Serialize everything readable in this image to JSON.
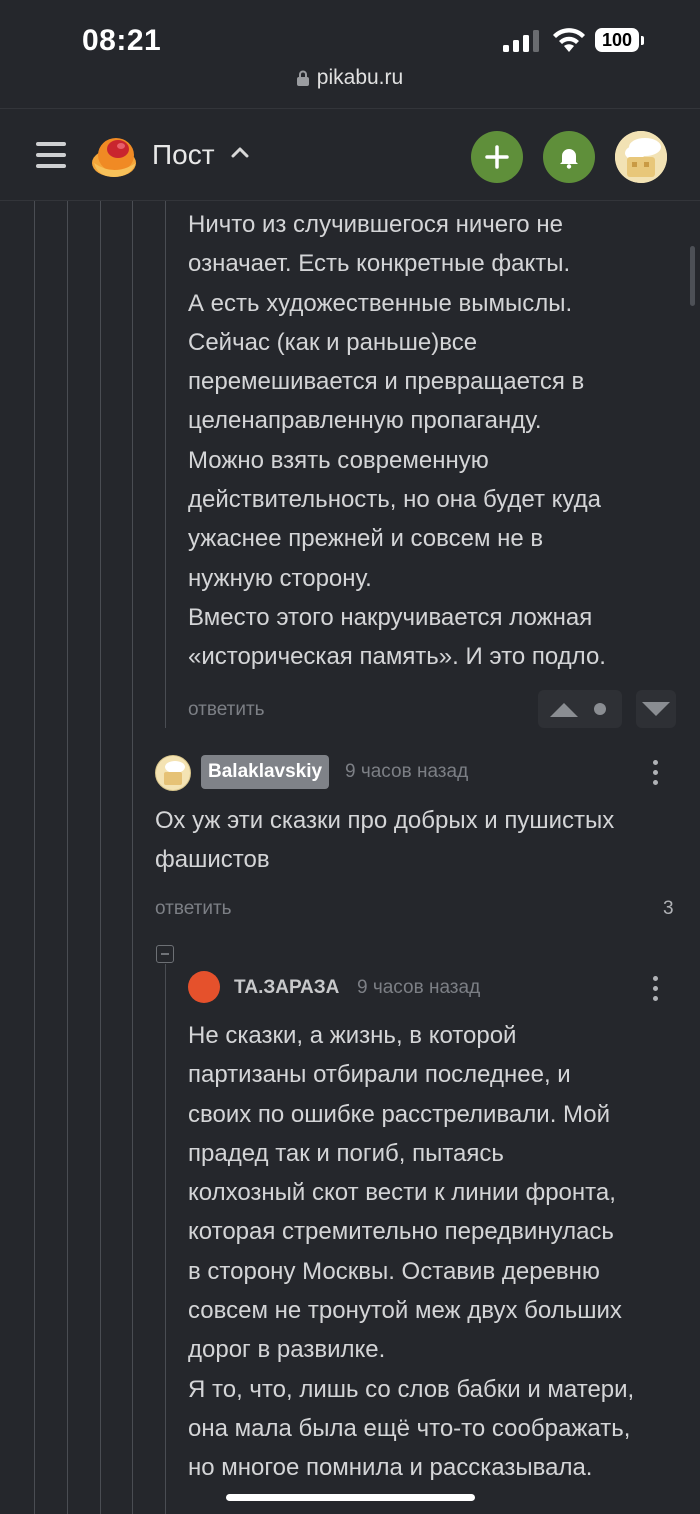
{
  "status_bar": {
    "time": "08:21",
    "battery": "100",
    "url": "pikabu.ru"
  },
  "header": {
    "title": "Пост",
    "menu_icon": "hamburger-icon",
    "logo_icon": "pikabu-logo-icon",
    "add_icon": "plus-icon",
    "bell_icon": "bell-icon",
    "accent": "#5f8f3a"
  },
  "comments": [
    {
      "lines": [
        "Ничто из случившегося ничего не",
        "означает. Есть конкретные факты.",
        "А есть художественные вымыслы.",
        "Сейчас (как и раньше)все",
        "перемешивается и превращается в",
        "целенаправленную пропаганду.",
        "Можно взять современную",
        "действительность, но она будет куда",
        "ужаснее прежней и совсем не в",
        "нужную сторону.",
        "Вместо этого накручивается ложная",
        "«историческая память». И это подло."
      ],
      "reply_label": "ответить"
    },
    {
      "author": "Balaklavskiy",
      "time": "9 часов назад",
      "lines": [
        "Ох уж эти сказки про добрых и пушистых",
        "фашистов"
      ],
      "reply_label": "ответить",
      "rating": "3"
    },
    {
      "author": "ТА.ЗАРАЗА",
      "time": "9 часов назад",
      "avatar_color": "#e5512c",
      "lines": [
        "Не сказки, а жизнь, в которой",
        "партизаны отбирали последнее, и",
        "своих по ошибке расстреливали. Мой",
        "прадед так и погиб, пытаясь",
        "колхозный скот вести к линии фронта,",
        "которая стремительно передвинулась",
        "в сторону Москвы. Оставив деревню",
        "совсем не тронутой меж двух больших",
        "дорог в развилке.",
        "Я то, что, лишь со слов бабки и матери,",
        "она мала была ещё что-то соображать,",
        "но многое помнила и рассказывала."
      ]
    }
  ]
}
